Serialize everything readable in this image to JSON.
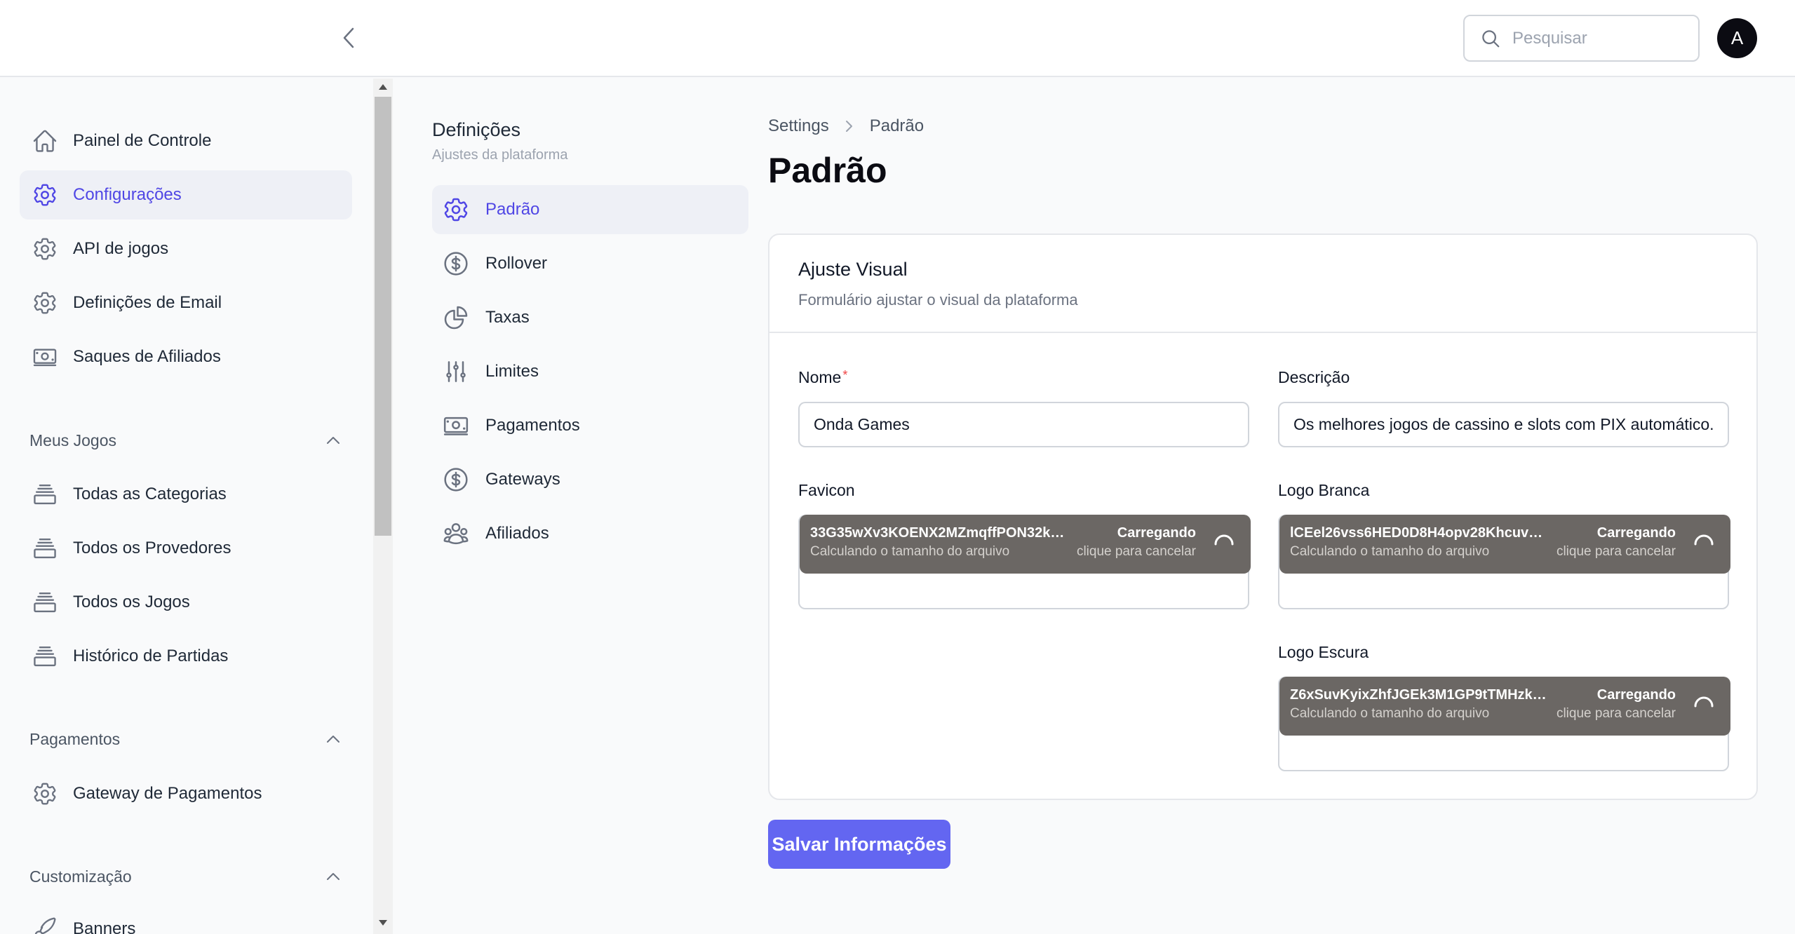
{
  "header": {
    "search_placeholder": "Pesquisar",
    "avatar_initial": "A"
  },
  "sidebar": {
    "items": [
      {
        "label": "Painel de Controle",
        "icon": "home-icon"
      },
      {
        "label": "Configurações",
        "icon": "gear-icon",
        "active": true
      },
      {
        "label": "API de jogos",
        "icon": "gear-icon"
      },
      {
        "label": "Definições de Email",
        "icon": "gear-icon"
      },
      {
        "label": "Saques de Afiliados",
        "icon": "banknote-icon"
      }
    ],
    "sections": [
      {
        "title": "Meus Jogos",
        "items": [
          {
            "label": "Todas as Categorias",
            "icon": "stack-icon"
          },
          {
            "label": "Todos os Provedores",
            "icon": "stack-icon"
          },
          {
            "label": "Todos os Jogos",
            "icon": "stack-icon"
          },
          {
            "label": "Histórico de Partidas",
            "icon": "stack-icon"
          }
        ]
      },
      {
        "title": "Pagamentos",
        "items": [
          {
            "label": "Gateway de Pagamentos",
            "icon": "gear-icon"
          }
        ]
      },
      {
        "title": "Customização",
        "items": [
          {
            "label": "Banners",
            "icon": "brush-icon"
          }
        ]
      }
    ]
  },
  "settings_nav": {
    "title": "Definições",
    "subtitle": "Ajustes da plataforma",
    "items": [
      {
        "label": "Padrão",
        "icon": "gear-icon",
        "active": true
      },
      {
        "label": "Rollover",
        "icon": "dollar-circle-icon"
      },
      {
        "label": "Taxas",
        "icon": "pie-chart-icon"
      },
      {
        "label": "Limites",
        "icon": "sliders-icon"
      },
      {
        "label": "Pagamentos",
        "icon": "banknote-icon"
      },
      {
        "label": "Gateways",
        "icon": "dollar-circle-icon"
      },
      {
        "label": "Afiliados",
        "icon": "users-icon"
      }
    ]
  },
  "main": {
    "breadcrumb": [
      "Settings",
      "Padrão"
    ],
    "title": "Padrão",
    "card": {
      "title": "Ajuste Visual",
      "subtitle": "Formulário ajustar o visual da plataforma",
      "nome_label": "Nome",
      "nome_required_mark": "*",
      "nome_value": "Onda Games",
      "descricao_label": "Descrição",
      "descricao_value": "Os melhores jogos de cassino e slots com PIX automático.",
      "files": [
        {
          "label": "Favicon",
          "filename": "33G35wXv3KOENX2MZmqffPON32ksR2x...",
          "size_text": "Calculando o tamanho do arquivo",
          "status": "Carregando",
          "cancel_text": "clique para cancelar"
        },
        {
          "label": "Logo Branca",
          "filename": "lCEel26vss6HED0D8H4opv28Khcuv63zvW...",
          "size_text": "Calculando o tamanho do arquivo",
          "status": "Carregando",
          "cancel_text": "clique para cancelar"
        },
        {
          "label": "Logo Escura",
          "filename": "Z6xSuvKyixZhfJGEk3M1GP9tTMHzkjlRm...",
          "size_text": "Calculando o tamanho do arquivo",
          "status": "Carregando",
          "cancel_text": "clique para cancelar"
        }
      ]
    },
    "save_label": "Salvar Informações"
  },
  "colors": {
    "accent": "#6366f1",
    "active_text": "#4f46e5",
    "active_bg": "#eef0f6",
    "file_item_bg": "#6b6764"
  }
}
